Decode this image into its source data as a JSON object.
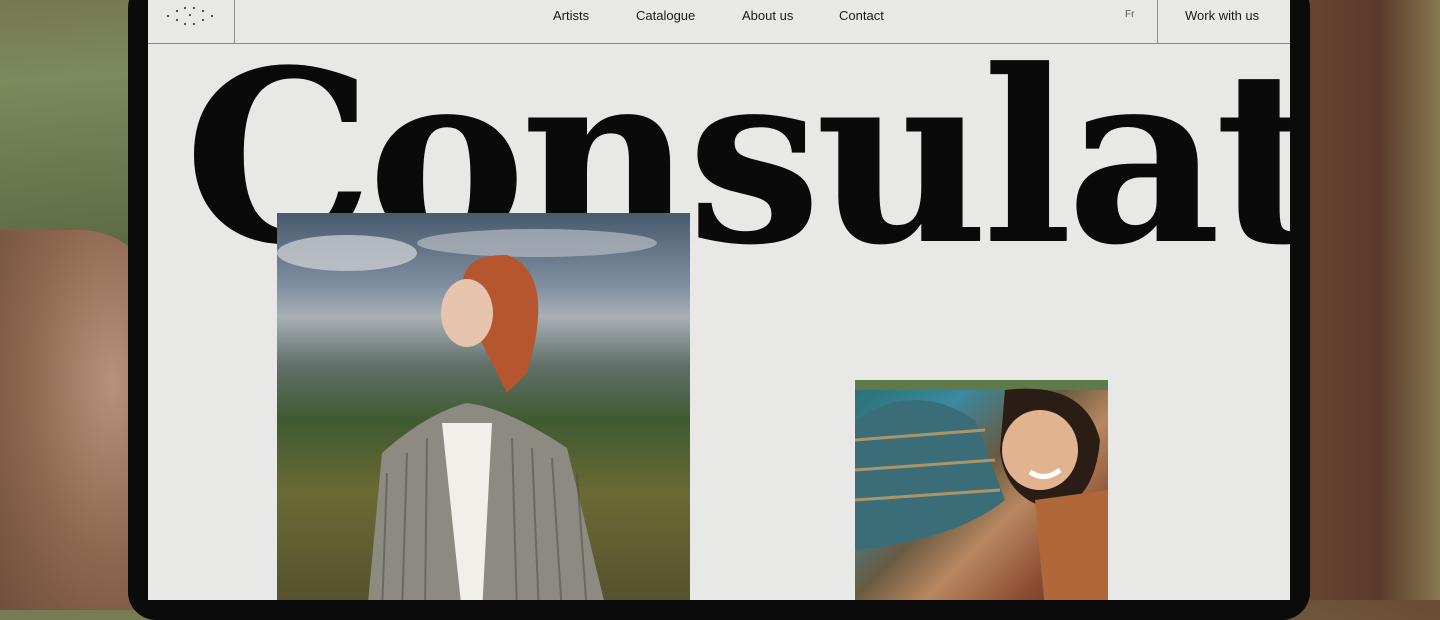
{
  "nav": {
    "links": [
      "Artists",
      "Catalogue",
      "About us",
      "Contact"
    ],
    "lang": "Fr",
    "cta": "Work with us"
  },
  "hero": {
    "title": "Consulat"
  },
  "images": [
    {
      "name": "model-portrait"
    },
    {
      "name": "smiling-model-portrait"
    }
  ],
  "colors": {
    "screen_bg": "#e8e8e6",
    "text": "#0a0a0a",
    "rule": "#8a8a8a"
  }
}
